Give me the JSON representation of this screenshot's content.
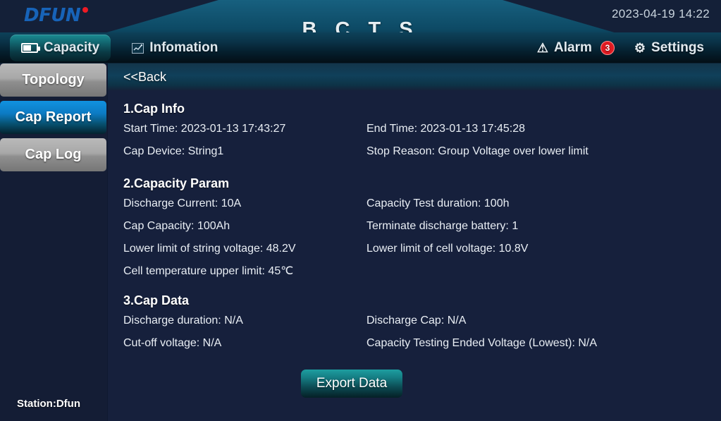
{
  "header": {
    "logo_text": "DFUN",
    "app_title": "B C T S",
    "datetime": "2023-04-19 14:22"
  },
  "navbar": {
    "tabs": [
      {
        "label": "Capacity",
        "icon": "battery-icon",
        "active": true
      },
      {
        "label": "Infomation",
        "icon": "chart-icon",
        "active": false
      }
    ],
    "alarm": {
      "label": "Alarm",
      "icon": "warning-icon",
      "count": "3"
    },
    "settings": {
      "label": "Settings",
      "icon": "gear-icon"
    }
  },
  "sidebar": {
    "items": [
      {
        "label": "Topology",
        "active": false
      },
      {
        "label": "Cap Report",
        "active": true
      },
      {
        "label": "Cap Log",
        "active": false
      }
    ],
    "station": "Station:Dfun"
  },
  "content": {
    "back_label": "<<Back",
    "sections": [
      {
        "title": "1.Cap Info",
        "rows": [
          {
            "left": "Start Time: 2023-01-13 17:43:27",
            "right": "End Time: 2023-01-13 17:45:28"
          },
          {
            "left": "Cap Device: String1",
            "right": "Stop Reason: Group Voltage over lower limit"
          }
        ]
      },
      {
        "title": "2.Capacity Param",
        "rows": [
          {
            "left": "Discharge Current: 10A",
            "right": "Capacity Test duration: 100h"
          },
          {
            "left": "Cap Capacity: 100Ah",
            "right": "Terminate discharge battery: 1"
          },
          {
            "left": "Lower limit of string voltage: 48.2V",
            "right": "Lower limit of cell voltage: 10.8V"
          },
          {
            "left": "Cell temperature upper limit: 45℃",
            "right": ""
          }
        ]
      },
      {
        "title": "3.Cap Data",
        "rows": [
          {
            "left": "Discharge duration: N/A",
            "right": "Discharge Cap: N/A"
          },
          {
            "left": "Cut-off voltage: N/A",
            "right": "Capacity Testing Ended Voltage (Lowest): N/A"
          }
        ]
      }
    ],
    "export_label": "Export Data"
  },
  "colors": {
    "page_bg": "#16203c",
    "sidebar_bg": "#141d35",
    "accent_teal": "#1a8c93",
    "accent_blue": "#0c7bc4",
    "alarm_red": "#e01b22",
    "logo_blue": "#1763b8"
  }
}
